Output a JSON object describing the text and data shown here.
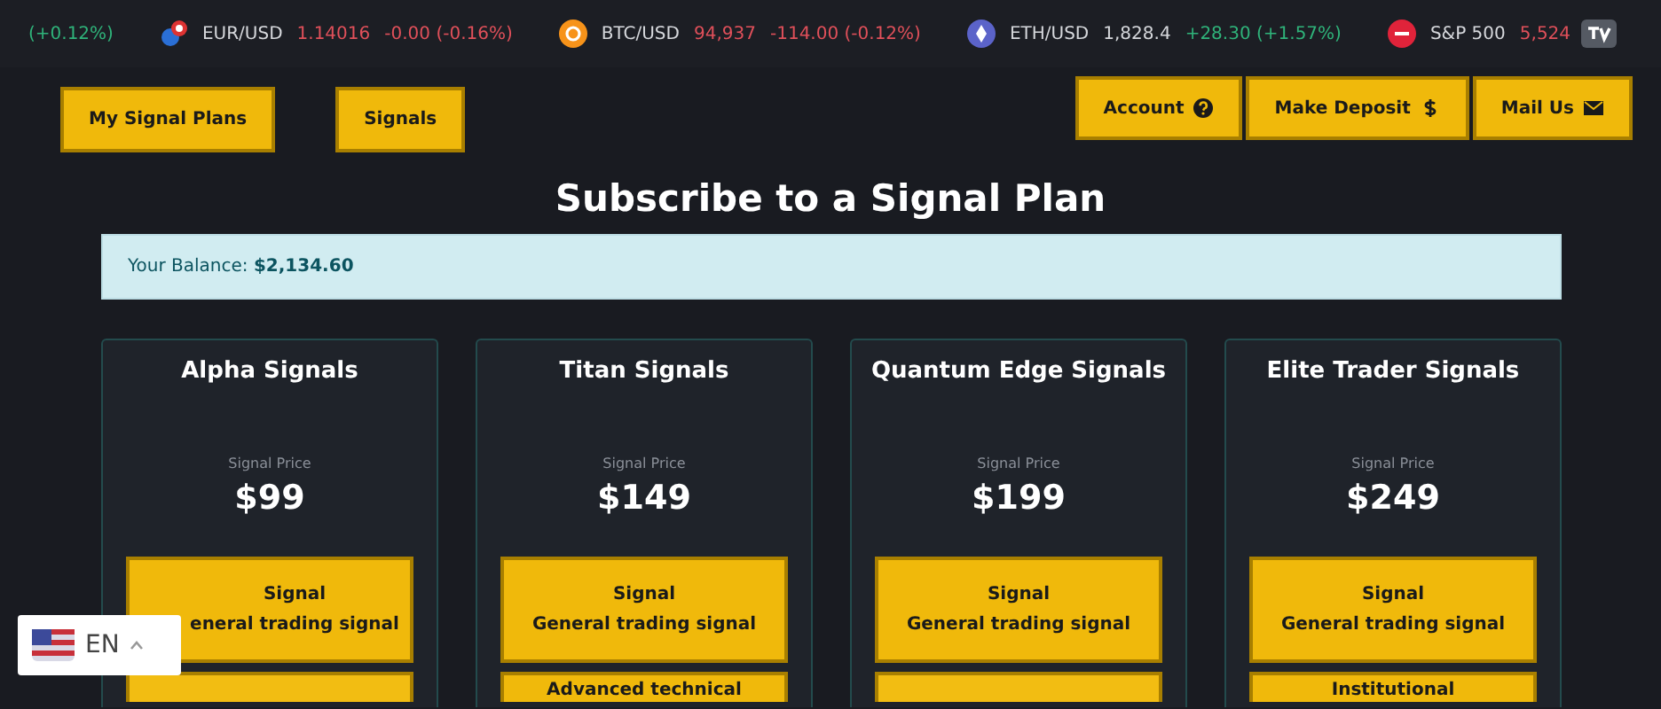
{
  "ticker": [
    {
      "change": "(+0.12%)",
      "color": "#2fb37a"
    },
    {
      "symbol": "EUR/USD",
      "price": "1.14016",
      "change": "-0.00 (-0.16%)",
      "color": "#e0505a"
    },
    {
      "symbol": "BTC/USD",
      "price": "94,937",
      "change": "-114.00 (-0.12%)",
      "color": "#e0505a"
    },
    {
      "symbol": "ETH/USD",
      "price": "1,828.4",
      "change": "+28.30 (+1.57%)",
      "color": "#2fb37a"
    },
    {
      "symbol": "S&P 500",
      "price": "5,524",
      "color": "#e0505a"
    }
  ],
  "nav_left": [
    "My Signal Plans",
    "Signals"
  ],
  "nav_right": [
    "Account",
    "Make Deposit",
    "Mail Us"
  ],
  "heading": "Subscribe to a Signal Plan",
  "balance": {
    "label": "Your Balance:",
    "amount": "$2,134.60"
  },
  "plans": [
    {
      "name": "Alpha Signals",
      "price_label": "Signal Price",
      "price": "$99",
      "features": [
        {
          "kind": "text",
          "title": "Signal",
          "detail": "eneral trading signal"
        },
        {
          "kind": "blank"
        }
      ]
    },
    {
      "name": "Titan Signals",
      "price_label": "Signal Price",
      "price": "$149",
      "features": [
        {
          "kind": "text",
          "title": "Signal",
          "detail": "General trading signal"
        },
        {
          "kind": "text",
          "title": "Advanced technical"
        }
      ]
    },
    {
      "name": "Quantum Edge Signals",
      "price_label": "Signal Price",
      "price": "$199",
      "features": [
        {
          "kind": "text",
          "title": "Signal",
          "detail": "General trading signal"
        },
        {
          "kind": "blank"
        }
      ]
    },
    {
      "name": "Elite Trader Signals",
      "price_label": "Signal Price",
      "price": "$249",
      "features": [
        {
          "kind": "text",
          "title": "Signal",
          "detail": "General trading signal"
        },
        {
          "kind": "text",
          "title": "Institutional"
        }
      ]
    }
  ],
  "language": {
    "code": "EN"
  }
}
